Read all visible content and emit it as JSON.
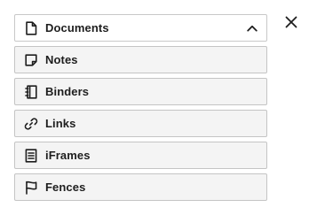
{
  "menu": {
    "items": [
      {
        "label": "Documents",
        "icon": "document-icon",
        "expanded": true
      },
      {
        "label": "Notes",
        "icon": "note-icon"
      },
      {
        "label": "Binders",
        "icon": "binder-icon"
      },
      {
        "label": "Links",
        "icon": "link-icon"
      },
      {
        "label": "iFrames",
        "icon": "iframe-icon"
      },
      {
        "label": "Fences",
        "icon": "flag-icon"
      }
    ]
  },
  "controls": {
    "collapse_icon": "chevron-up-icon",
    "close_icon": "close-icon"
  },
  "colors": {
    "text": "#1e1e1e",
    "border": "#c4c4c4",
    "item_bg": "#f4f4f4",
    "active_bg": "#ffffff"
  }
}
